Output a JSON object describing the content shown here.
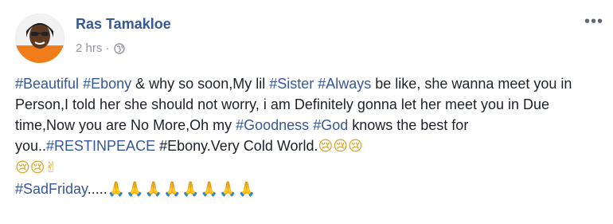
{
  "post": {
    "author_name": "Ras Tamakloe",
    "time": "2 hrs",
    "separator": "·",
    "privacy_icon": "globe-icon",
    "more_icon": "more-options-icon",
    "more_glyph": "•••"
  },
  "body": {
    "segments": [
      {
        "type": "tag",
        "text": "#Beautiful"
      },
      {
        "type": "text",
        "text": " "
      },
      {
        "type": "tag",
        "text": "#Ebony"
      },
      {
        "type": "text",
        "text": " & why so soon,My lil "
      },
      {
        "type": "tag",
        "text": "#Sister"
      },
      {
        "type": "text",
        "text": " "
      },
      {
        "type": "tag",
        "text": "#Always"
      },
      {
        "type": "text",
        "text": " be like, she wanna meet you in Person,I told her she should not worry, i am Definitely gonna let her meet you in Due time,Now you are No More,Oh my "
      },
      {
        "type": "tag",
        "text": "#Goodness"
      },
      {
        "type": "text",
        "text": " "
      },
      {
        "type": "tag",
        "text": "#God"
      },
      {
        "type": "text",
        "text": " knows the best for you.."
      },
      {
        "type": "tag",
        "text": "#RESTINPEACE"
      },
      {
        "type": "text",
        "text": " #Ebony.Very Cold World."
      },
      {
        "type": "emoji",
        "cls": "cry",
        "text": "😢😢😢"
      },
      {
        "type": "break"
      },
      {
        "type": "emoji",
        "cls": "cry",
        "text": "😢😢"
      },
      {
        "type": "emoji",
        "cls": "pray",
        "text": "✌"
      },
      {
        "type": "break"
      },
      {
        "type": "tag",
        "text": "#SadFriday"
      },
      {
        "type": "text",
        "text": "....."
      },
      {
        "type": "emoji",
        "cls": "pray",
        "text": "🙏🙏🙏🙏🙏🙏🙏🙏"
      }
    ]
  },
  "colors": {
    "link": "#365899",
    "meta": "#90949c",
    "text": "#1d2129"
  }
}
